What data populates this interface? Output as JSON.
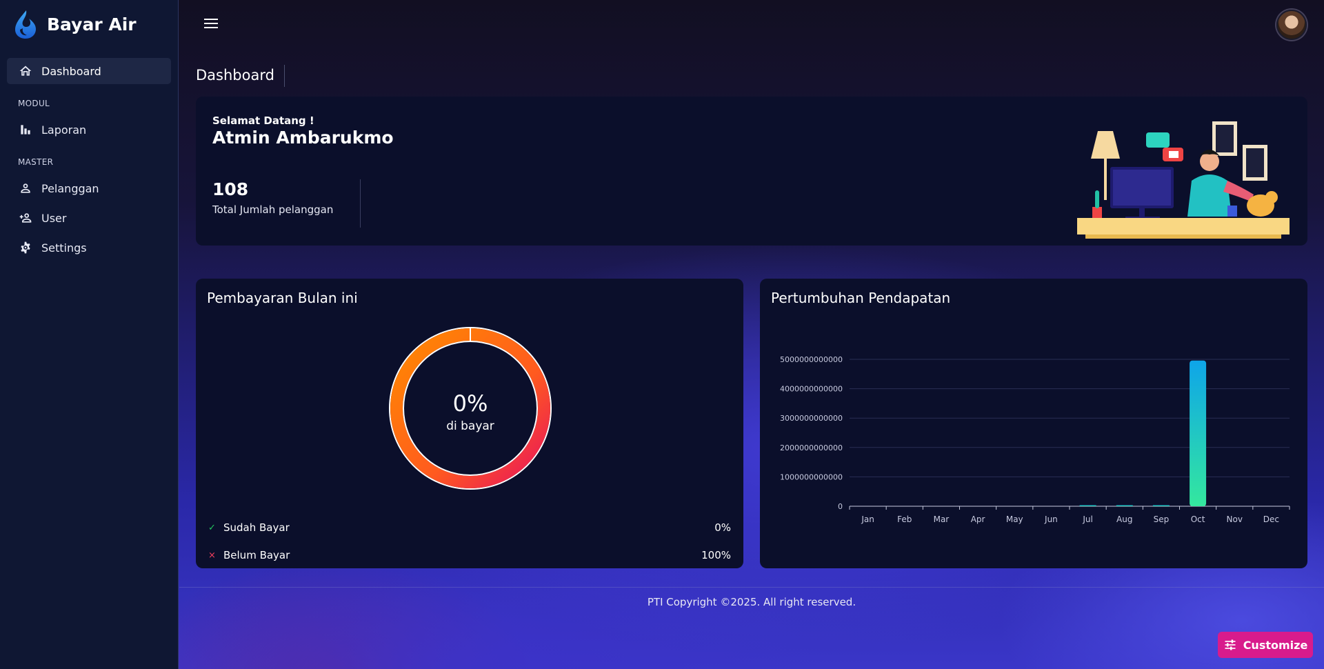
{
  "app": {
    "name": "Bayar Air"
  },
  "sidebar": {
    "items": [
      {
        "label": "Dashboard",
        "icon": "home-icon",
        "active": true
      },
      {
        "section": "MODUL"
      },
      {
        "label": "Laporan",
        "icon": "bar-chart-icon"
      },
      {
        "section": "MASTER"
      },
      {
        "label": "Pelanggan",
        "icon": "person-icon"
      },
      {
        "label": "User",
        "icon": "add-user-icon"
      },
      {
        "label": "Settings",
        "icon": "gear-icon"
      }
    ]
  },
  "page": {
    "title": "Dashboard"
  },
  "welcome": {
    "greeting": "Selamat Datang !",
    "name": "Atmin Ambarukmo",
    "stat_value": "108",
    "stat_label": "Total Jumlah pelanggan"
  },
  "payment_card": {
    "title": "Pembayaran Bulan ini",
    "center_value": "0%",
    "center_label": "di bayar",
    "legend": [
      {
        "label": "Sudah Bayar",
        "value": "0%",
        "mark": "✓",
        "color": "#22c55e"
      },
      {
        "label": "Belum Bayar",
        "value": "100%",
        "mark": "×",
        "color": "#f43f5e"
      }
    ]
  },
  "growth_card": {
    "title": "Pertumbuhan Pendapatan"
  },
  "chart_data": {
    "type": "bar",
    "categories": [
      "Jan",
      "Feb",
      "Mar",
      "Apr",
      "May",
      "Jun",
      "Jul",
      "Aug",
      "Sep",
      "Oct",
      "Nov",
      "Dec"
    ],
    "values": [
      0,
      0,
      0,
      0,
      0,
      0,
      5000000000,
      6000000000,
      5000000000,
      4960000000000,
      0,
      0
    ],
    "yticks": [
      "0",
      "1000000000000",
      "2000000000000",
      "3000000000000",
      "4000000000000",
      "5000000000000"
    ],
    "ylim": [
      0,
      5000000000000
    ],
    "grid": true,
    "colors": {
      "bar_top": "#0ea5e9",
      "bar_bottom": "#34e89e"
    }
  },
  "footer": {
    "text": "PTI Copyright ©2025. All right reserved."
  },
  "customize": {
    "label": "Customize"
  },
  "colors": {
    "accent": "#d81b8c",
    "sidebar": "#0f1733",
    "card": "#0b0f2b"
  }
}
